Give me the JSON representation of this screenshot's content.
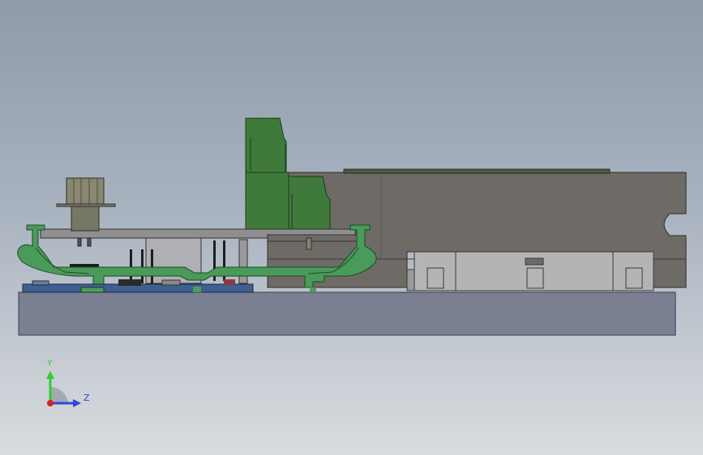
{
  "viewport": {
    "background_top": "#8e9bab",
    "background_bottom": "#d9dcdf"
  },
  "triad": {
    "y_label": "Y",
    "z_label": "Z",
    "y_color": "#2fcf2f",
    "z_color": "#2f47d8",
    "origin_color": "#d62020"
  },
  "colors": {
    "base_plate": "#7b7f92",
    "body_gray": "#6e6b66",
    "light_gray": "#b4b4b4",
    "mid_gray": "#8f8f8f",
    "green_part": "#3f7a3a",
    "green_section": "#4a9a5a",
    "blue_board": "#3e5f8f",
    "dark": "#2a2a2a",
    "cylinder": "#8a8770"
  }
}
